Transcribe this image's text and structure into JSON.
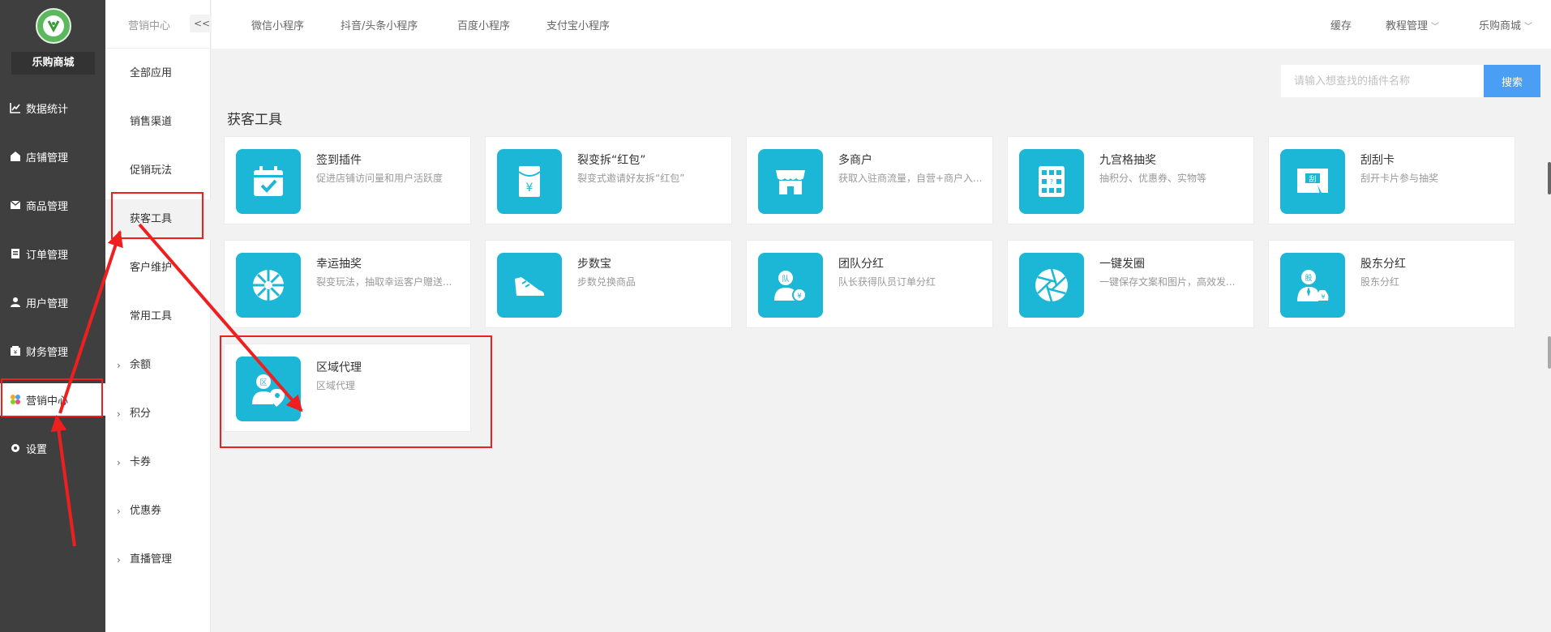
{
  "sidebar": {
    "shop_name": "乐购商城",
    "items": [
      {
        "label": "数据统计",
        "icon": "chart-icon"
      },
      {
        "label": "店铺管理",
        "icon": "store-icon"
      },
      {
        "label": "商品管理",
        "icon": "goods-icon"
      },
      {
        "label": "订单管理",
        "icon": "order-icon"
      },
      {
        "label": "用户管理",
        "icon": "user-icon"
      },
      {
        "label": "财务管理",
        "icon": "finance-icon"
      },
      {
        "label": "营销中心",
        "icon": "marketing-icon",
        "active": true
      },
      {
        "label": "设置",
        "icon": "settings-icon"
      }
    ]
  },
  "subnav": {
    "title": "营销中心",
    "collapse_label": "<<",
    "items": [
      {
        "label": "全部应用"
      },
      {
        "label": "销售渠道"
      },
      {
        "label": "促销玩法"
      },
      {
        "label": "获客工具",
        "active": true
      },
      {
        "label": "客户维护"
      },
      {
        "label": "常用工具"
      },
      {
        "label": "余额",
        "chevron": true
      },
      {
        "label": "积分",
        "chevron": true
      },
      {
        "label": "卡券",
        "chevron": true
      },
      {
        "label": "优惠券",
        "chevron": true
      },
      {
        "label": "直播管理",
        "chevron": true
      }
    ]
  },
  "topbar": {
    "tabs": [
      "微信小程序",
      "抖音/头条小程序",
      "百度小程序",
      "支付宝小程序"
    ],
    "right": [
      {
        "label": "缓存",
        "caret": false
      },
      {
        "label": "教程管理",
        "caret": true
      },
      {
        "label": "乐购商城",
        "caret": true
      }
    ]
  },
  "search": {
    "placeholder": "请输入想查找的插件名称",
    "button_label": "搜索"
  },
  "section_title": "获客工具",
  "cards": [
    {
      "title": "签到插件",
      "desc": "促进店铺访问量和用户活跃度",
      "icon": "calendar-check-icon"
    },
    {
      "title": "裂变拆“红包”",
      "desc": "裂变式邀请好友拆“红包”",
      "icon": "red-envelope-icon"
    },
    {
      "title": "多商户",
      "desc": "获取入驻商流量，自营+商户入...",
      "icon": "storefront-icon"
    },
    {
      "title": "九宫格抽奖",
      "desc": "抽积分、优惠券、实物等",
      "icon": "grid-lottery-icon"
    },
    {
      "title": "刮刮卡",
      "desc": "刮开卡片参与抽奖",
      "icon": "scratch-card-icon"
    },
    {
      "title": "幸运抽奖",
      "desc": "裂变玩法，抽取幸运客户赠送...",
      "icon": "wheel-icon"
    },
    {
      "title": "步数宝",
      "desc": "步数兑换商品",
      "icon": "sneaker-icon"
    },
    {
      "title": "团队分红",
      "desc": "队长获得队员订单分红",
      "icon": "team-dividend-icon"
    },
    {
      "title": "一键发圈",
      "desc": "一键保存文案和图片，高效发...",
      "icon": "aperture-icon"
    },
    {
      "title": "股东分红",
      "desc": "股东分红",
      "icon": "shareholder-icon"
    },
    {
      "title": "区域代理",
      "desc": "区域代理",
      "icon": "area-agent-icon"
    }
  ],
  "colors": {
    "sidebar_bg": "#3f3f3f",
    "icon_bg": "#1cb7d6",
    "accent": "#4a9ff5",
    "annotation": "#f01f1f"
  }
}
